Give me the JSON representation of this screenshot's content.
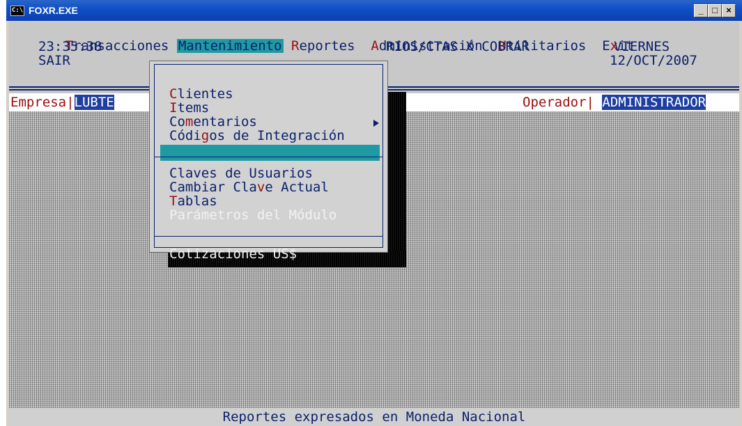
{
  "window": {
    "title": "FOXR.EXE",
    "icon_text": "C:\\",
    "minimize": "_",
    "maximize": "□",
    "close": "×"
  },
  "menubar": {
    "items": [
      {
        "hot": "T",
        "rest": "ransacciones"
      },
      {
        "hot": "",
        "rest": "Mantenimiento"
      },
      {
        "hot": "R",
        "rest": "eportes"
      },
      {
        "hot": "A",
        "rest": "dministración"
      },
      {
        "hot": "U",
        "rest": "tilitarios"
      },
      {
        "pre": "E",
        "hot": "x",
        "rest": "it"
      }
    ]
  },
  "header": {
    "time": "23:35:38",
    "user": "SAIR",
    "module": "RIOS/CTAS X COBRAR",
    "weekday": "VIERNES",
    "date": "12/OCT/2007"
  },
  "empresa": {
    "label": "Empresa|",
    "value": "LUBTE"
  },
  "operador": {
    "label": "Operador|",
    "value": "ADMINISTRADOR"
  },
  "dropdown": {
    "items": [
      {
        "hot": "C",
        "rest": "lientes"
      },
      {
        "hot": "I",
        "rest": "tems"
      },
      {
        "pre": "Co",
        "hot": "m",
        "rest": "entarios"
      },
      {
        "pre": "Códi",
        "hot": "g",
        "rest": "os de Integración"
      },
      {
        "pre": "",
        "hot": "",
        "rest": "Claves de Usuarios"
      },
      {
        "pre": "Cambiar Cla",
        "hot": "v",
        "rest": "e Actual"
      },
      {
        "hot": "T",
        "rest": "ablas"
      },
      {
        "pre": "",
        "hot": "",
        "rest": "Parámetros del Módulo"
      },
      {
        "pre": "",
        "hot": "",
        "rest": "Cotizaciones US$"
      }
    ]
  },
  "status": {
    "text": "Reportes expresados en Moneda Nacional"
  }
}
